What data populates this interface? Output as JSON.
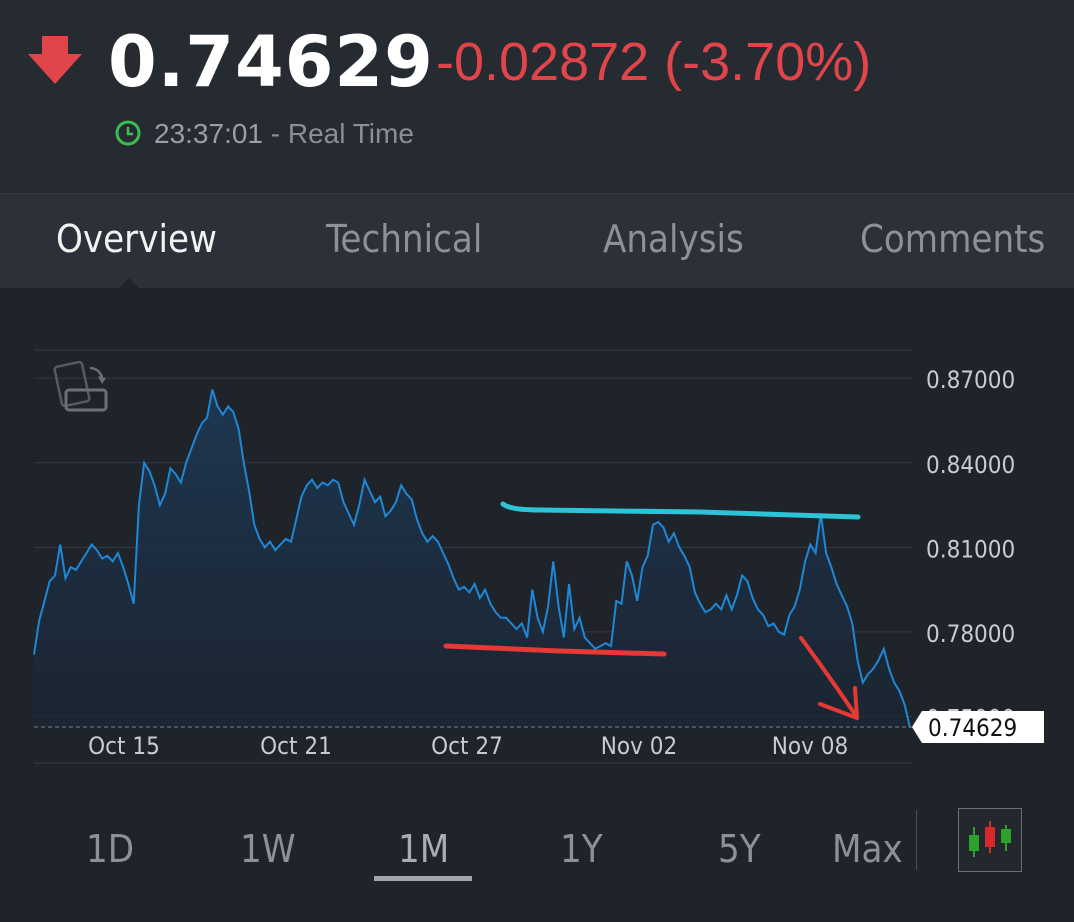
{
  "quote": {
    "price": "0.74629",
    "change": "-0.02872 (-3.70%)",
    "time": "23:37:01",
    "time_suffix": " - Real Time",
    "direction_icon": "arrow-down-icon",
    "clock_icon": "clock-icon"
  },
  "tabs": [
    {
      "label": "Overview",
      "active": true
    },
    {
      "label": "Technical",
      "active": false
    },
    {
      "label": "Analysis",
      "active": false
    },
    {
      "label": "Comments",
      "active": false
    }
  ],
  "ranges": [
    {
      "label": "1D",
      "active": false
    },
    {
      "label": "1W",
      "active": false
    },
    {
      "label": "1M",
      "active": true
    },
    {
      "label": "1Y",
      "active": false
    },
    {
      "label": "5Y",
      "active": false
    },
    {
      "label": "Max",
      "active": false
    }
  ],
  "icons": {
    "rotate": "rotate-screen-icon",
    "candlestick": "candlestick-chart-icon"
  },
  "colors": {
    "up": "#e0454a",
    "line": "#1e88d6",
    "annotation_cyan": "#2ec4d8",
    "annotation_red": "#e53935"
  },
  "chart_data": {
    "type": "area",
    "x_ticks": [
      "Oct 15",
      "Oct 21",
      "Oct 27",
      "Nov 02",
      "Nov 08"
    ],
    "y_ticks": [
      "0.87000",
      "0.84000",
      "0.81000",
      "0.78000",
      "0.75000"
    ],
    "ylim": [
      0.7335,
      0.88
    ],
    "current_value": 0.74629,
    "current_label": "0.74629",
    "grid": true,
    "series": [
      {
        "values": [
          0.772,
          0.784,
          0.791,
          0.798,
          0.8,
          0.811,
          0.799,
          0.803,
          0.802,
          0.805,
          0.808,
          0.811,
          0.809,
          0.806,
          0.807,
          0.805,
          0.808,
          0.803,
          0.797,
          0.79,
          0.825,
          0.84,
          0.837,
          0.832,
          0.825,
          0.829,
          0.838,
          0.836,
          0.833,
          0.84,
          0.845,
          0.85,
          0.854,
          0.856,
          0.866,
          0.86,
          0.857,
          0.86,
          0.858,
          0.852,
          0.84,
          0.83,
          0.818,
          0.813,
          0.81,
          0.812,
          0.809,
          0.811,
          0.813,
          0.812,
          0.82,
          0.828,
          0.832,
          0.834,
          0.831,
          0.833,
          0.832,
          0.834,
          0.833,
          0.826,
          0.822,
          0.818,
          0.825,
          0.834,
          0.83,
          0.826,
          0.828,
          0.821,
          0.823,
          0.826,
          0.832,
          0.829,
          0.827,
          0.82,
          0.815,
          0.812,
          0.814,
          0.812,
          0.808,
          0.804,
          0.799,
          0.795,
          0.796,
          0.794,
          0.797,
          0.792,
          0.795,
          0.79,
          0.787,
          0.785,
          0.785,
          0.783,
          0.781,
          0.783,
          0.778,
          0.795,
          0.785,
          0.78,
          0.789,
          0.805,
          0.789,
          0.778,
          0.797,
          0.781,
          0.785,
          0.778,
          0.776,
          0.774,
          0.775,
          0.776,
          0.775,
          0.791,
          0.79,
          0.805,
          0.8,
          0.791,
          0.803,
          0.807,
          0.818,
          0.819,
          0.817,
          0.812,
          0.815,
          0.81,
          0.807,
          0.803,
          0.794,
          0.79,
          0.787,
          0.788,
          0.79,
          0.788,
          0.793,
          0.788,
          0.793,
          0.8,
          0.798,
          0.792,
          0.788,
          0.786,
          0.782,
          0.783,
          0.78,
          0.779,
          0.786,
          0.789,
          0.795,
          0.805,
          0.811,
          0.808,
          0.822,
          0.808,
          0.803,
          0.797,
          0.793,
          0.789,
          0.783,
          0.77,
          0.762,
          0.765,
          0.767,
          0.77,
          0.774,
          0.767,
          0.762,
          0.759,
          0.754,
          0.746
        ]
      }
    ]
  }
}
